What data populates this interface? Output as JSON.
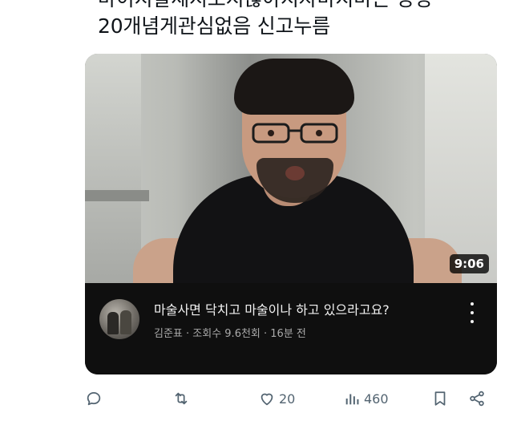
{
  "tweet": {
    "text_line1": "마이지팔세지오지않아지자마지마는 당장",
    "text_line2": "20개념게관심없음 신고누름"
  },
  "video": {
    "duration": "9:06",
    "title": "마술사면 닥치고 마술이나 하고 있으라고요?",
    "meta": "김준표 · 조회수 9.6천회 · 16분 전",
    "channel_avatar_icon": "channel-avatar"
  },
  "actions": {
    "reply_icon": "reply-icon",
    "retweet_icon": "retweet-icon",
    "like_icon": "heart-icon",
    "like_count": "20",
    "views_icon": "views-icon",
    "views_count": "460",
    "bookmark_icon": "bookmark-icon",
    "share_icon": "share-icon"
  },
  "colors": {
    "card_bg": "#0f0f0f",
    "action_gray": "#536471",
    "title_white": "#f1f1f1",
    "meta_gray": "#aaaaaa"
  }
}
